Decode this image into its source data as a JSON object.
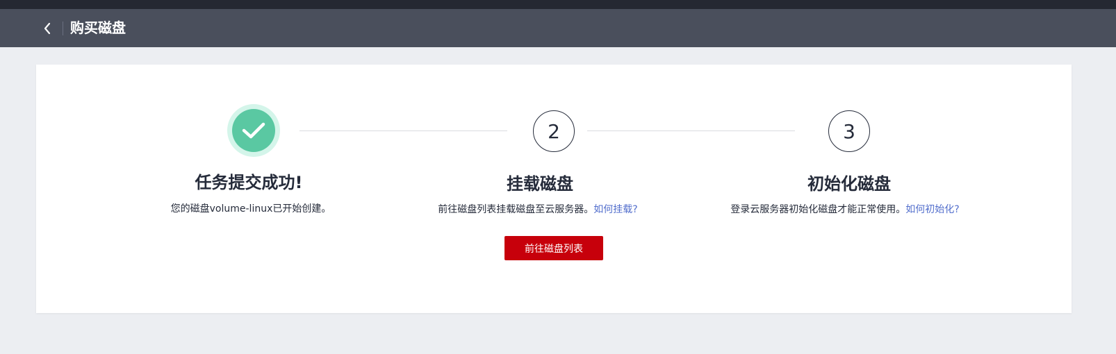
{
  "header": {
    "title": "购买磁盘",
    "back_icon": "chevron-left-icon"
  },
  "colors": {
    "header_bg": "#4a4f5c",
    "success": "#5ac8a2",
    "primary": "#c7000b",
    "link": "#526ecc"
  },
  "steps": [
    {
      "indicator": "check-icon",
      "status": "completed",
      "title": "任务提交成功!",
      "description": "您的磁盘volume-linux已开始创建。"
    },
    {
      "indicator": "2",
      "status": "pending",
      "title": "挂载磁盘",
      "description": "前往磁盘列表挂载磁盘至云服务器。",
      "link": "如何挂载?"
    },
    {
      "indicator": "3",
      "status": "pending",
      "title": "初始化磁盘",
      "description": "登录云服务器初始化磁盘才能正常使用。",
      "link": "如何初始化?"
    }
  ],
  "actions": {
    "go_to_disk_list_label": "前往磁盘列表"
  }
}
